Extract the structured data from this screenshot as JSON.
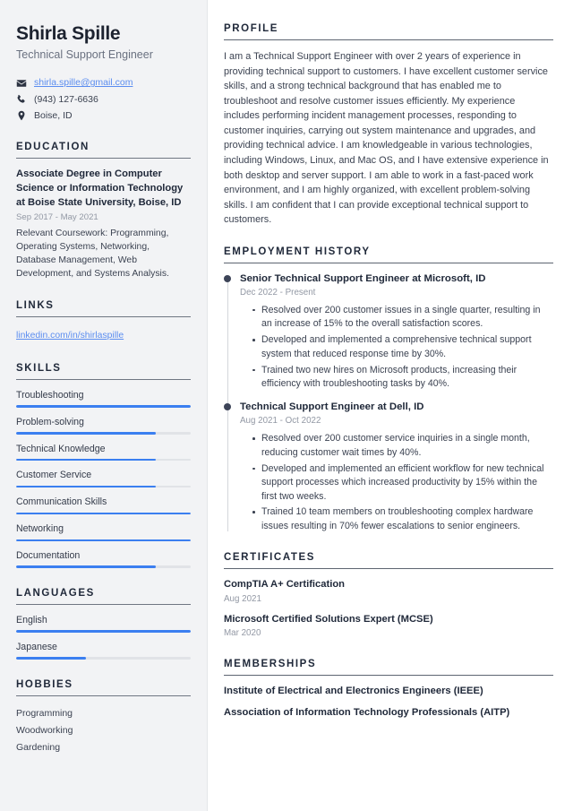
{
  "theme": {
    "sidebar_bg": "#f2f3f5",
    "page_bg": "#ffffff",
    "heading_color": "#20293a",
    "body_color": "#3b4251",
    "muted_color": "#9298a4",
    "accent_blue": "#3b7ff0",
    "link_blue": "#5b8df0",
    "meter_track": "#e1e3e7",
    "timeline_dot": "#3d4458"
  },
  "sidebar": {
    "name": "Shirla Spille",
    "job_title": "Technical Support Engineer",
    "contacts": [
      {
        "icon": "envelope-icon",
        "text": "shirla.spille@gmail.com",
        "is_link": true
      },
      {
        "icon": "phone-icon",
        "text": "(943) 127-6636",
        "is_link": false
      },
      {
        "icon": "map-pin-icon",
        "text": "Boise, ID",
        "is_link": false
      }
    ],
    "education": {
      "heading": "EDUCATION",
      "entries": [
        {
          "degree": "Associate Degree in Computer Science or Information Technology at Boise State University, Boise, ID",
          "date": "Sep 2017 - May 2021",
          "description": "Relevant Coursework: Programming, Operating Systems, Networking, Database Management, Web Development, and Systems Analysis."
        }
      ]
    },
    "links": {
      "heading": "LINKS",
      "items": [
        {
          "label": "linkedin.com/in/shirlaspille"
        }
      ]
    },
    "skills": {
      "heading": "SKILLS",
      "items": [
        {
          "label": "Troubleshooting",
          "level": 100
        },
        {
          "label": "Problem-solving",
          "level": 80
        },
        {
          "label": "Technical Knowledge",
          "level": 80
        },
        {
          "label": "Customer Service",
          "level": 80
        },
        {
          "label": "Communication Skills",
          "level": 100
        },
        {
          "label": "Networking",
          "level": 100
        },
        {
          "label": "Documentation",
          "level": 80
        }
      ]
    },
    "languages": {
      "heading": "LANGUAGES",
      "items": [
        {
          "label": "English",
          "level": 100
        },
        {
          "label": "Japanese",
          "level": 40
        }
      ]
    },
    "hobbies": {
      "heading": "HOBBIES",
      "items": [
        {
          "label": "Programming"
        },
        {
          "label": "Woodworking"
        },
        {
          "label": "Gardening"
        }
      ]
    }
  },
  "main": {
    "profile": {
      "heading": "PROFILE",
      "text": "I am a Technical Support Engineer with over 2 years of experience in providing technical support to customers. I have excellent customer service skills, and a strong technical background that has enabled me to troubleshoot and resolve customer issues efficiently. My experience includes performing incident management processes, responding to customer inquiries, carrying out system maintenance and upgrades, and providing technical advice. I am knowledgeable in various technologies, including Windows, Linux, and Mac OS, and I have extensive experience in both desktop and server support. I am able to work in a fast-paced work environment, and I am highly organized, with excellent problem-solving skills. I am confident that I can provide exceptional technical support to customers."
    },
    "employment": {
      "heading": "EMPLOYMENT HISTORY",
      "jobs": [
        {
          "role": "Senior Technical Support Engineer at Microsoft, ID",
          "date": "Dec 2022 - Present",
          "bullets": [
            "Resolved over 200 customer issues in a single quarter, resulting in an increase of 15% to the overall satisfaction scores.",
            "Developed and implemented a comprehensive technical support system that reduced response time by 30%.",
            "Trained two new hires on Microsoft products, increasing their efficiency with troubleshooting tasks by 40%."
          ]
        },
        {
          "role": "Technical Support Engineer at Dell, ID",
          "date": "Aug 2021 - Oct 2022",
          "bullets": [
            "Resolved over 200 customer service inquiries in a single month, reducing customer wait times by 40%.",
            "Developed and implemented an efficient workflow for new technical support processes which increased productivity by 15% within the first two weeks.",
            "Trained 10 team members on troubleshooting complex hardware issues resulting in 70% fewer escalations to senior engineers."
          ]
        }
      ]
    },
    "certificates": {
      "heading": "CERTIFICATES",
      "items": [
        {
          "title": "CompTIA A+ Certification",
          "date": "Aug 2021"
        },
        {
          "title": "Microsoft Certified Solutions Expert (MCSE)",
          "date": "Mar 2020"
        }
      ]
    },
    "memberships": {
      "heading": "MEMBERSHIPS",
      "items": [
        {
          "title": "Institute of Electrical and Electronics Engineers (IEEE)"
        },
        {
          "title": "Association of Information Technology Professionals (AITP)"
        }
      ]
    }
  }
}
